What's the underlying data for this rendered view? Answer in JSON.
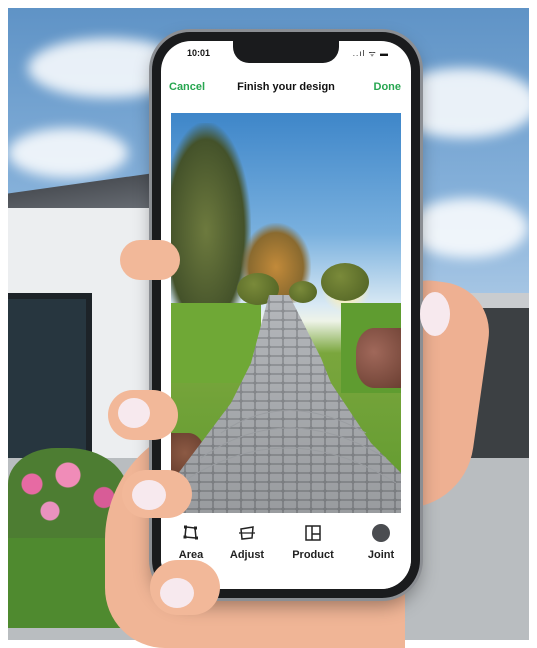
{
  "status_bar": {
    "time": "10:01",
    "icons": "..ıl ᯤ ▬"
  },
  "header": {
    "cancel_label": "Cancel",
    "title": "Finish your design",
    "done_label": "Done"
  },
  "toolbar": {
    "items": [
      {
        "label": "Area",
        "icon": "area-crop-icon"
      },
      {
        "label": "Adjust",
        "icon": "adjust-perspective-icon"
      },
      {
        "label": "Product",
        "icon": "product-layout-icon"
      },
      {
        "label": "Joint",
        "icon": "joint-circle-icon"
      }
    ]
  },
  "colors": {
    "accent": "#27a650",
    "joint_swatch": "#4a4c50"
  }
}
